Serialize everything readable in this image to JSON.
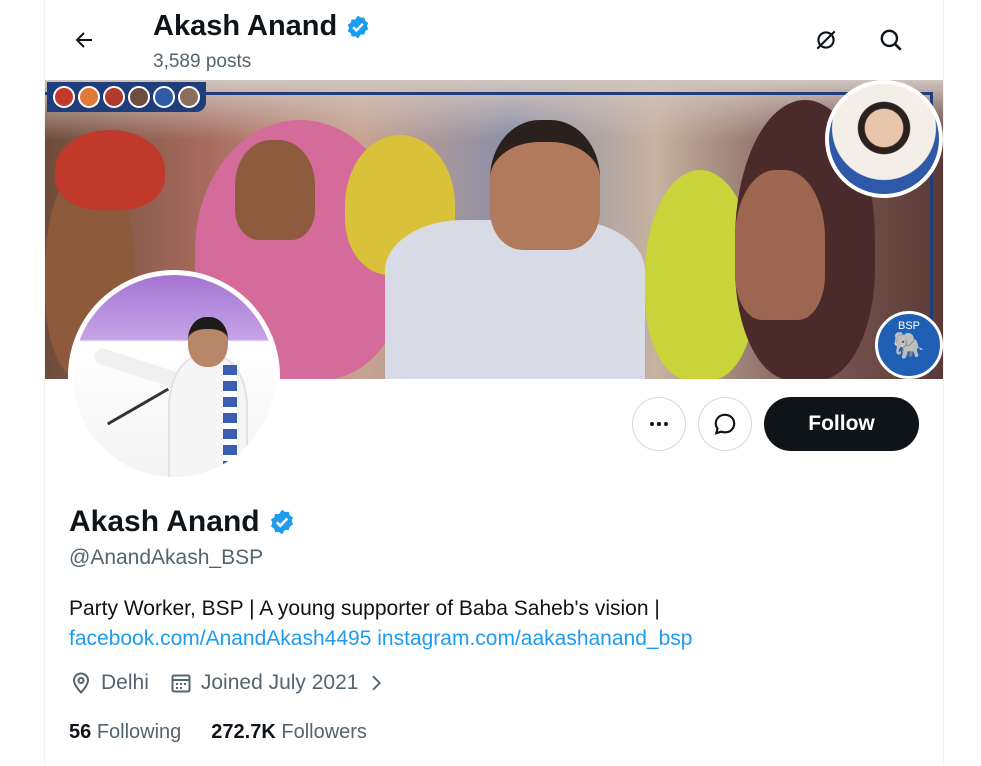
{
  "header": {
    "name": "Akash Anand",
    "posts": "3,589 posts"
  },
  "banner": {
    "bsp_label": "BSP"
  },
  "actions": {
    "follow_label": "Follow"
  },
  "profile": {
    "name": "Akash Anand",
    "handle": "@AnandAkash_BSP",
    "bio_text": "Party Worker, BSP | A young supporter of Baba Saheb's vision |",
    "links": [
      "facebook.com/AnandAkash4495",
      "instagram.com/aakashanand_bsp"
    ],
    "location": "Delhi",
    "joined": "Joined July 2021"
  },
  "stats": {
    "following_count": "56",
    "following_label": "Following",
    "followers_count": "272.7K",
    "followers_label": "Followers"
  },
  "colors": {
    "link": "#1d9bf0",
    "verified": "#1d9bf0",
    "follow_button": "#0f1419",
    "secondary_text": "#536471",
    "banner_frame": "#1e3d7a"
  },
  "icons": [
    "back-arrow-icon",
    "grok-icon",
    "search-icon",
    "more-icon",
    "message-icon",
    "verified-badge-icon",
    "location-icon",
    "calendar-icon",
    "chevron-right-icon"
  ]
}
